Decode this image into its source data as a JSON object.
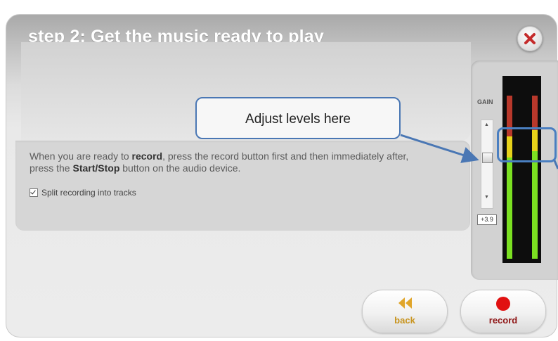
{
  "dialog": {
    "title": "step 2: Get the music ready to play",
    "close_icon": "close-x-icon"
  },
  "instructions": {
    "part1": "When you are ready to ",
    "bold1": "record",
    "part2": ", press the record button first and then immediately after, press the ",
    "bold2": "Start/Stop",
    "part3": " button on the audio device."
  },
  "options": {
    "split_tracks_label": "Split recording into tracks",
    "split_tracks_checked": true
  },
  "gain": {
    "label": "GAIN",
    "value": "+3.9",
    "level_fraction": 0.4
  },
  "meters": {
    "left_level_fraction": 0.62,
    "right_level_fraction": 0.66,
    "colors": {
      "green": "#7be021",
      "yellow": "#e7d21a",
      "red": "#b8382b"
    }
  },
  "annotation": {
    "callout_text": "Adjust levels here",
    "accent_color": "#4a77b4"
  },
  "buttons": {
    "back": {
      "label": "back",
      "icon": "double-chevron-left-icon",
      "color": "#e0a52a"
    },
    "record": {
      "label": "record",
      "icon": "record-dot-icon",
      "color": "#9b1b1b"
    }
  }
}
